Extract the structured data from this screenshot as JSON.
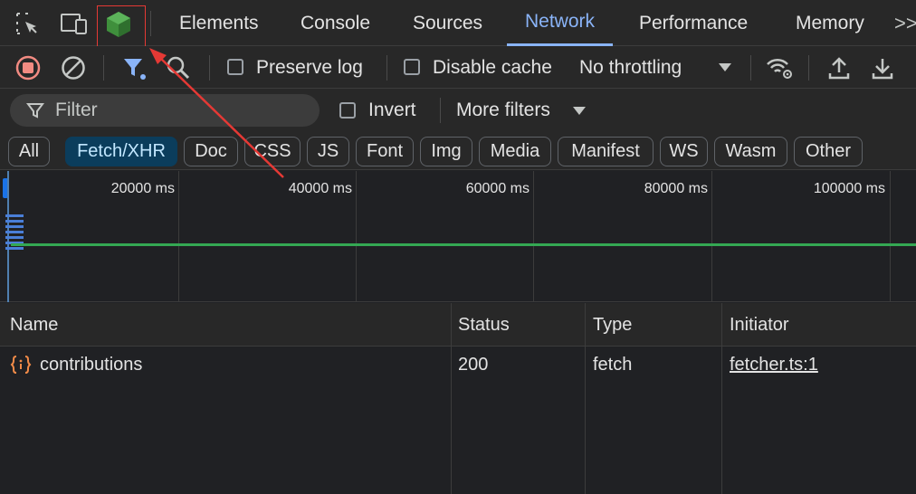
{
  "tabs": {
    "elements": "Elements",
    "console": "Console",
    "sources": "Sources",
    "network": "Network",
    "performance": "Performance",
    "memory": "Memory",
    "overflow": ">>"
  },
  "toolbar": {
    "preserve_log": "Preserve log",
    "disable_cache": "Disable cache",
    "throttling": "No throttling"
  },
  "filterbar": {
    "filter_placeholder": "Filter",
    "invert": "Invert",
    "more_filters": "More filters"
  },
  "chips": [
    "All",
    "Fetch/XHR",
    "Doc",
    "CSS",
    "JS",
    "Font",
    "Img",
    "Media",
    "Manifest",
    "WS",
    "Wasm",
    "Other"
  ],
  "active_chip": "Fetch/XHR",
  "overview": {
    "ticks": [
      "20000 ms",
      "40000 ms",
      "60000 ms",
      "80000 ms",
      "100000 ms"
    ]
  },
  "table": {
    "headers": {
      "name": "Name",
      "status": "Status",
      "type": "Type",
      "initiator": "Initiator"
    },
    "rows": [
      {
        "name": "contributions",
        "status": "200",
        "type": "fetch",
        "initiator": "fetcher.ts:1"
      }
    ]
  },
  "colors": {
    "accent": "#8ab4f8",
    "record_red": "#f28b82",
    "timeline_green": "#34a853",
    "annotation_red": "#e53935",
    "extension_green": "#3f8f3c"
  }
}
